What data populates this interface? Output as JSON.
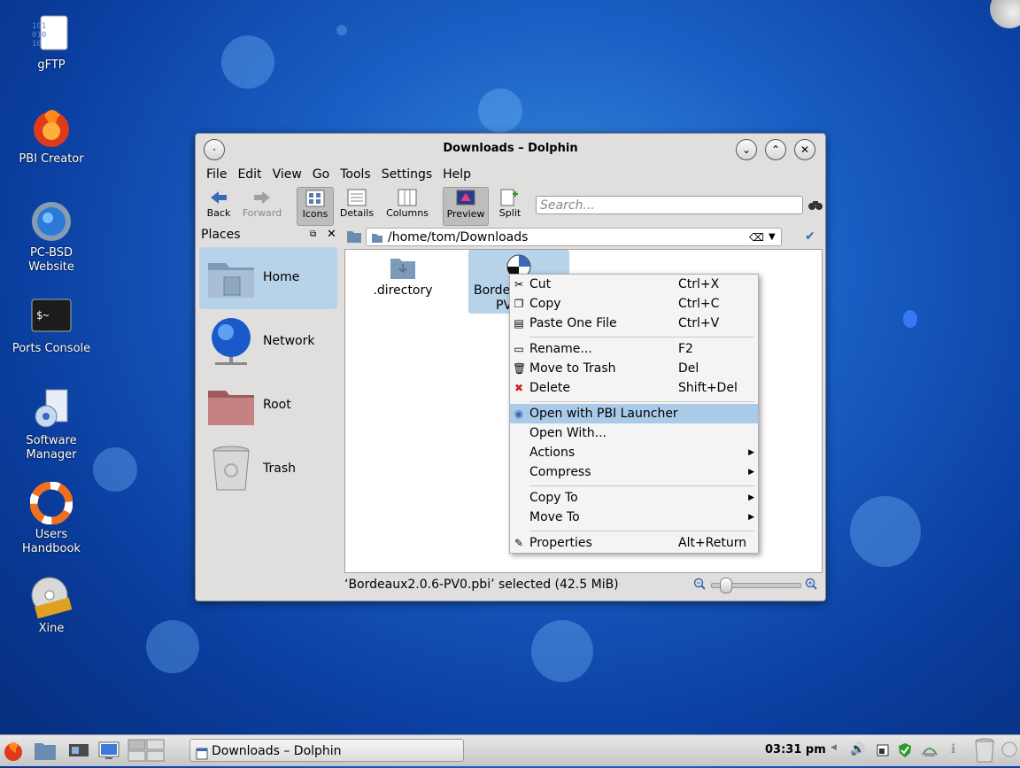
{
  "desktop": {
    "icons": [
      {
        "label": "gFTP"
      },
      {
        "label": "PBI Creator"
      },
      {
        "label": "PC-BSD Website"
      },
      {
        "label": "Ports Console"
      },
      {
        "label": "Software Manager"
      },
      {
        "label": "Users Handbook"
      },
      {
        "label": "Xine"
      }
    ],
    "console_prompt": "$~"
  },
  "window": {
    "title": "Downloads – Dolphin",
    "menu": [
      "File",
      "Edit",
      "View",
      "Go",
      "Tools",
      "Settings",
      "Help"
    ],
    "toolbar": {
      "back": "Back",
      "forward": "Forward",
      "icons": "Icons",
      "details": "Details",
      "columns": "Columns",
      "preview": "Preview",
      "split": "Split",
      "search_placeholder": "Search..."
    },
    "places": {
      "header": "Places",
      "items": [
        {
          "label": "Home"
        },
        {
          "label": "Network"
        },
        {
          "label": "Root"
        },
        {
          "label": "Trash"
        }
      ]
    },
    "path": "/home/tom/Downloads",
    "files": [
      {
        "name": ".directory"
      },
      {
        "name": "Borde",
        "name2": "PV"
      }
    ],
    "status": "‘Bordeaux2.0.6-PV0.pbi’ selected (42.5 MiB)",
    "zoom_level": 0.1
  },
  "context_menu": {
    "items": [
      {
        "label": "Cut",
        "shortcut": "Ctrl+X"
      },
      {
        "label": "Copy",
        "shortcut": "Ctrl+C"
      },
      {
        "label": "Paste One File",
        "shortcut": "Ctrl+V"
      },
      {
        "label": "Rename...",
        "shortcut": "F2"
      },
      {
        "label": "Move to Trash",
        "shortcut": "Del"
      },
      {
        "label": "Delete",
        "shortcut": "Shift+Del"
      },
      {
        "label": "Open with PBI Launcher",
        "shortcut": ""
      },
      {
        "label": "Open With...",
        "shortcut": ""
      },
      {
        "label": "Actions",
        "shortcut": ""
      },
      {
        "label": "Compress",
        "shortcut": ""
      },
      {
        "label": "Copy To",
        "shortcut": ""
      },
      {
        "label": "Move To",
        "shortcut": ""
      },
      {
        "label": "Properties",
        "shortcut": "Alt+Return"
      }
    ]
  },
  "taskbar": {
    "task_label": "Downloads – Dolphin",
    "clock": "03:31 pm"
  },
  "colors": {
    "highlight": "#a9cbe8",
    "selection": "#b7d3ea",
    "desktop": "#1a5fc4"
  }
}
